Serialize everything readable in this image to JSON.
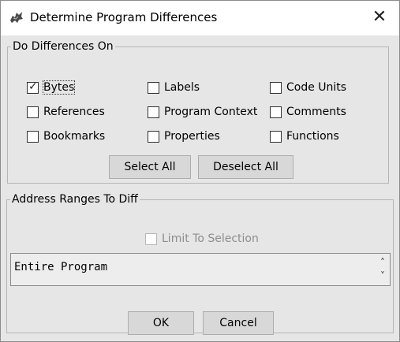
{
  "window": {
    "title": "Determine Program Differences",
    "close_glyph": "✕",
    "icon": "dragon-app-icon"
  },
  "diff_group": {
    "legend": "Do Differences On",
    "checkboxes": [
      {
        "label": "Bytes",
        "checked": true
      },
      {
        "label": "Labels",
        "checked": false
      },
      {
        "label": "Code Units",
        "checked": false
      },
      {
        "label": "References",
        "checked": false
      },
      {
        "label": "Program Context",
        "checked": false
      },
      {
        "label": "Comments",
        "checked": false
      },
      {
        "label": "Bookmarks",
        "checked": false
      },
      {
        "label": "Properties",
        "checked": false
      },
      {
        "label": "Functions",
        "checked": false
      }
    ],
    "select_all": "Select All",
    "deselect_all": "Deselect All"
  },
  "range_group": {
    "legend": "Address Ranges To Diff",
    "limit_to_selection": {
      "label": "Limit To Selection",
      "checked": false,
      "enabled": false
    },
    "range_value": "Entire Program",
    "spin_up": "˄",
    "spin_down": "˅"
  },
  "footer": {
    "ok": "OK",
    "cancel": "Cancel"
  },
  "check_glyph": "✓",
  "colors": {
    "background": "#e6e6e6",
    "button": "#d8d8d8",
    "disabled_text": "#8d8d8d"
  }
}
